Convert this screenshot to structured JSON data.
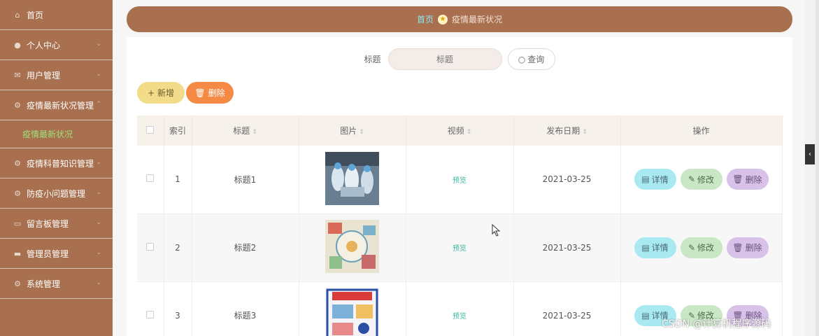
{
  "sidebar": {
    "items": [
      {
        "label": "首页",
        "icon": "home-icon",
        "chevron": false
      },
      {
        "label": "个人中心",
        "icon": "user-icon",
        "chevron": true
      },
      {
        "label": "用户管理",
        "icon": "mail-icon",
        "chevron": true
      },
      {
        "label": "疫情最新状况管理",
        "icon": "settings-icon",
        "chevron": true,
        "expanded": true
      },
      {
        "label": "疫情科普知识管理",
        "icon": "settings-icon",
        "chevron": true
      },
      {
        "label": "防疫小问题管理",
        "icon": "settings-icon",
        "chevron": true
      },
      {
        "label": "留言板管理",
        "icon": "chat-icon",
        "chevron": true
      },
      {
        "label": "管理员管理",
        "icon": "briefcase-icon",
        "chevron": true
      },
      {
        "label": "系统管理",
        "icon": "settings-icon",
        "chevron": true
      }
    ],
    "sub_item": "疫情最新状况"
  },
  "breadcrumb": {
    "home": "首页",
    "current": "疫情最新状况"
  },
  "search": {
    "label": "标题",
    "placeholder": "标题",
    "button": "查询"
  },
  "toolbar": {
    "add": "新增",
    "delete": "删除"
  },
  "table": {
    "headers": [
      "",
      "索引",
      "标题",
      "图片",
      "视频",
      "发布日期",
      "操作"
    ],
    "rows": [
      {
        "index": "1",
        "title": "标题1",
        "video": "预览",
        "date": "2021-03-25"
      },
      {
        "index": "2",
        "title": "标题2",
        "video": "预览",
        "date": "2021-03-25"
      },
      {
        "index": "3",
        "title": "标题3",
        "video": "预览",
        "date": "2021-03-25"
      }
    ],
    "ops": {
      "detail": "详情",
      "edit": "修改",
      "delete": "删除"
    }
  },
  "watermark": "CSDN @计算机程序源码",
  "colors": {
    "sidebar": "#a8704e",
    "accent_green": "#9be27a",
    "delete": "#f58a45",
    "add": "#f2dc8a"
  }
}
